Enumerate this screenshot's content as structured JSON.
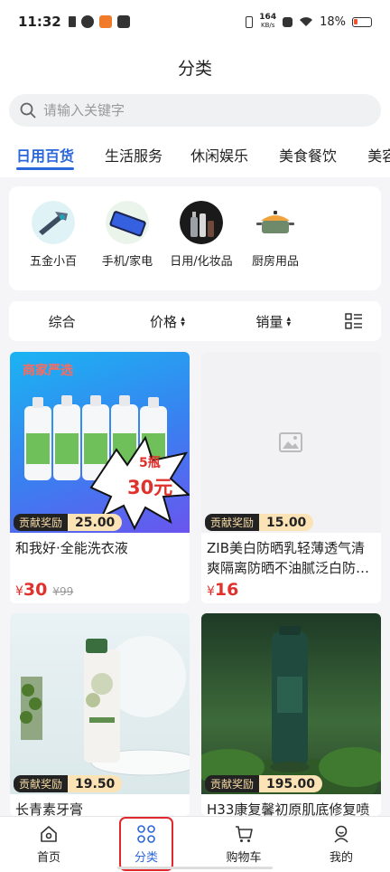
{
  "status_bar": {
    "time": "11:32",
    "net_speed_value": "164",
    "net_speed_unit": "KB/s",
    "battery": "18%"
  },
  "title": "分类",
  "search": {
    "placeholder": "请输入关键字",
    "value": ""
  },
  "tabs": [
    {
      "label": "日用百货",
      "active": true
    },
    {
      "label": "生活服务",
      "active": false
    },
    {
      "label": "休闲娱乐",
      "active": false
    },
    {
      "label": "美食餐饮",
      "active": false
    },
    {
      "label": "美容",
      "active": false
    }
  ],
  "categories": [
    {
      "label": "五金小百",
      "icon": "hardware-icon"
    },
    {
      "label": "手机/家电",
      "icon": "phone-icon"
    },
    {
      "label": "日用/化妆品",
      "icon": "cosmetics-icon"
    },
    {
      "label": "厨房用品",
      "icon": "pot-icon"
    }
  ],
  "sort_bar": {
    "overall": "综合",
    "price": "价格",
    "sales": "销量",
    "arrows": "▲▼"
  },
  "products": [
    {
      "name": "和我好·全能洗衣液",
      "reward_label": "贡献奖励",
      "reward_value": "25.00",
      "currency": "¥",
      "price": "30",
      "original_price": "¥99",
      "image_text": "商家严选",
      "promo_line1": "5瓶",
      "promo_line2": "30元"
    },
    {
      "name": "ZIB美白防晒乳轻薄透气清爽隔离防晒不油腻泛白防…",
      "reward_label": "贡献奖励",
      "reward_value": "15.00",
      "currency": "¥",
      "price": "16",
      "original_price": ""
    },
    {
      "name": "长青素牙膏",
      "reward_label": "贡献奖励",
      "reward_value": "19.50",
      "currency": "¥",
      "price": "",
      "original_price": ""
    },
    {
      "name": "H33康复馨初原肌底修复喷",
      "reward_label": "贡献奖励",
      "reward_value": "195.00",
      "currency": "¥",
      "price": "",
      "original_price": ""
    }
  ],
  "bottom_nav": [
    {
      "label": "首页",
      "icon": "home-icon",
      "active": false
    },
    {
      "label": "分类",
      "icon": "category-grid-icon",
      "active": true
    },
    {
      "label": "购物车",
      "icon": "cart-icon",
      "active": false
    },
    {
      "label": "我的",
      "icon": "profile-icon",
      "active": false
    }
  ],
  "colors": {
    "accent": "#2b67d9",
    "price": "#e0312c",
    "reward_bg": "#fbe3b6",
    "highlight": "#e0282e"
  }
}
